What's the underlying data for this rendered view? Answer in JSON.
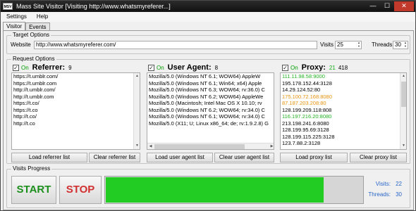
{
  "window": {
    "title": "Mass Site Visitor [Visiting http://www.whatsmyreferer...]",
    "icon_text": "MSV",
    "minimize_glyph": "—",
    "maximize_glyph": "☐",
    "close_glyph": "✕"
  },
  "menu": [
    "Settings",
    "Help"
  ],
  "tabs": [
    "Visitor",
    "Events"
  ],
  "target_options": {
    "legend": "Target Options",
    "website_label": "Website",
    "website_value": "http://www.whatsmyreferer.com/",
    "visits_label": "Visits",
    "visits_value": "25",
    "threads_label": "Threads",
    "threads_value": "30"
  },
  "request_options": {
    "legend": "Request Options",
    "referrer": {
      "on_label": "On",
      "header": "Referrer:",
      "count": "9",
      "items": [
        "https://t.umblr.com/",
        "https://t.umblr.com",
        "http://t.umblr.com/",
        "http://t.umblr.com",
        "https://t.co/",
        "https://t.co",
        "http://t.co/",
        "http://t.co"
      ],
      "load_button": "Load referrer list",
      "clear_button": "Clear referrer list"
    },
    "user_agent": {
      "on_label": "On",
      "header": "User Agent:",
      "count": "8",
      "items": [
        "Mozilla/5.0 (Windows NT 6.1; WOW64) AppleW",
        "Mozilla/5.0 (Windows NT 6.1; Win64; x64) Apple",
        "Mozilla/5.0 (Windows NT 6.3; WOW64; rv:36.0) C",
        "Mozilla/5.0 (Windows NT 6.2; WOW64) AppleWe",
        "Mozilla/5.0 (Macintosh; Intel Mac OS X 10.10; rv",
        "Mozilla/5.0 (Windows NT 6.2; WOW64; rv:34.0) C",
        "Mozilla/5.0 (Windows NT 6.1; WOW64; rv:34.0) C",
        "Mozilla/5.0 (X11; U; Linux x86_64; de; rv:1.9.2.8) G"
      ],
      "load_button": "Load user agent list",
      "clear_button": "Clear user agent list"
    },
    "proxy": {
      "on_label": "On",
      "header": "Proxy:",
      "count_good": "21",
      "count_total": "418",
      "items": [
        {
          "text": "111.11.98.58:9000",
          "color": "#22b022"
        },
        {
          "text": "195.178.152.44:3128",
          "color": "#000000"
        },
        {
          "text": "14.29.124.52:80",
          "color": "#000000"
        },
        {
          "text": "175.100.72.168:8080",
          "color": "#e8920c"
        },
        {
          "text": "87.187.203.208:80",
          "color": "#e8920c"
        },
        {
          "text": "128.199.209.118:808",
          "color": "#000000"
        },
        {
          "text": "116.197.216.20:8080",
          "color": "#22b022"
        },
        {
          "text": "213.198.241.6:8080",
          "color": "#000000"
        },
        {
          "text": "128.199.95.69:3128",
          "color": "#000000"
        },
        {
          "text": "128.199.115.225:3128",
          "color": "#000000"
        },
        {
          "text": "123.7.88.2:3128",
          "color": "#000000"
        }
      ],
      "load_button": "Load proxy list",
      "clear_button": "Clear proxy list"
    }
  },
  "visits_progress": {
    "legend": "Visits Progress",
    "start_label": "START",
    "start_color": "#1c8f1c",
    "stop_label": "STOP",
    "stop_color": "#d23030",
    "progress_fraction": 0.85,
    "progress_color": "#22cc22",
    "visits_label": "Visits:",
    "visits_value": "22",
    "threads_label": "Threads:",
    "threads_value": "30"
  },
  "icons": {
    "scroll_up": "▲",
    "scroll_down": "▼",
    "scroll_left": "◀",
    "scroll_right": "▶",
    "check": "✓"
  }
}
